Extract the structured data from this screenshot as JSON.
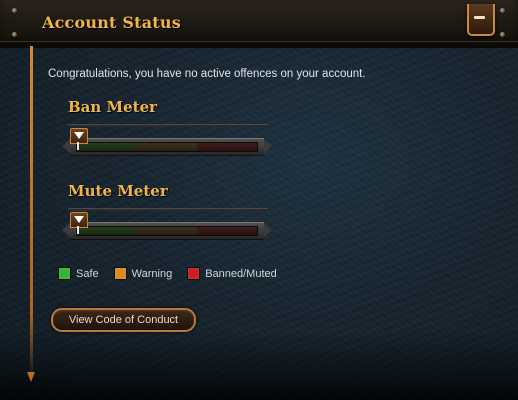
{
  "header": {
    "title": "Account Status"
  },
  "message": "Congratulations, you have no active offences on your account.",
  "meters": [
    {
      "title": "Ban Meter",
      "level": 0
    },
    {
      "title": "Mute Meter",
      "level": 0
    }
  ],
  "legend": [
    {
      "label": "Safe",
      "color": "#2fb52f"
    },
    {
      "label": "Warning",
      "color": "#d88a1e"
    },
    {
      "label": "Banned/Muted",
      "color": "#c82020"
    }
  ],
  "buttons": {
    "code_of_conduct": "View Code of Conduct"
  },
  "icons": {
    "collapse": "minimize-icon",
    "marker": "triangle-down-icon"
  }
}
